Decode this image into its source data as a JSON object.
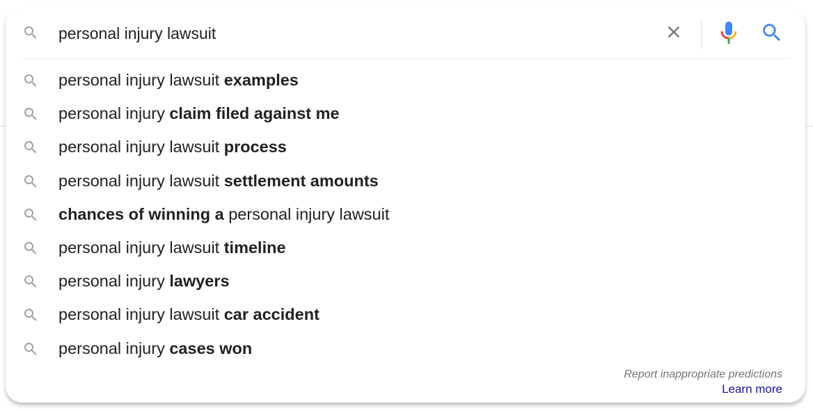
{
  "search": {
    "query": "personal injury lawsuit"
  },
  "suggestions": [
    {
      "parts": [
        {
          "t": "personal injury lawsuit ",
          "b": false
        },
        {
          "t": "examples",
          "b": true
        }
      ]
    },
    {
      "parts": [
        {
          "t": "personal injury ",
          "b": false
        },
        {
          "t": "claim filed against me",
          "b": true
        }
      ]
    },
    {
      "parts": [
        {
          "t": "personal injury lawsuit ",
          "b": false
        },
        {
          "t": "process",
          "b": true
        }
      ]
    },
    {
      "parts": [
        {
          "t": "personal injury lawsuit ",
          "b": false
        },
        {
          "t": "settlement amounts",
          "b": true
        }
      ]
    },
    {
      "parts": [
        {
          "t": "chances of winning a ",
          "b": true
        },
        {
          "t": "personal injury lawsuit",
          "b": false
        }
      ]
    },
    {
      "parts": [
        {
          "t": "personal injury lawsuit ",
          "b": false
        },
        {
          "t": "timeline",
          "b": true
        }
      ]
    },
    {
      "parts": [
        {
          "t": "personal injury ",
          "b": false
        },
        {
          "t": "lawyers",
          "b": true
        }
      ]
    },
    {
      "parts": [
        {
          "t": "personal injury lawsuit ",
          "b": false
        },
        {
          "t": "car accident",
          "b": true
        }
      ]
    },
    {
      "parts": [
        {
          "t": "personal injury ",
          "b": false
        },
        {
          "t": "cases won",
          "b": true
        }
      ]
    }
  ],
  "footer": {
    "report_label": "Report inappropriate predictions",
    "learn_more_label": "Learn more"
  },
  "icons": {
    "lead": "search-icon",
    "clear": "close-icon",
    "mic": "microphone-icon",
    "submit": "search-icon"
  },
  "colors": {
    "text": "#202124",
    "icon_gray": "#9aa0a6",
    "clear_gray": "#70757a",
    "google_blue": "#4285f4",
    "link": "#1a0dab"
  }
}
